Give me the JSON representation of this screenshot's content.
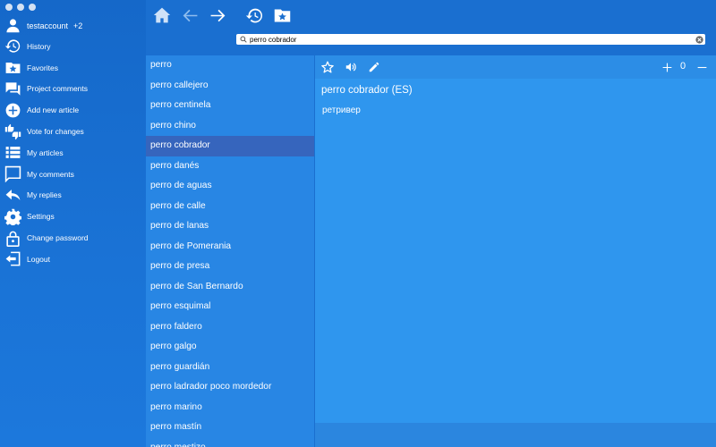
{
  "window": {
    "traffic_lights": [
      "close",
      "minimize",
      "zoom"
    ]
  },
  "user": {
    "name": "testaccount",
    "badge": "+2"
  },
  "sidebar": {
    "items": [
      {
        "label": "History",
        "icon": "history-icon"
      },
      {
        "label": "Favorites",
        "icon": "favorites-icon"
      },
      {
        "label": "Project comments",
        "icon": "comments-icon"
      },
      {
        "label": "Add new article",
        "icon": "add-icon"
      },
      {
        "label": "Vote for changes",
        "icon": "vote-icon"
      },
      {
        "label": "My articles",
        "icon": "articles-icon"
      },
      {
        "label": "My comments",
        "icon": "comment-icon"
      },
      {
        "label": "My replies",
        "icon": "reply-icon"
      },
      {
        "label": "Settings",
        "icon": "gear-icon"
      },
      {
        "label": "Change password",
        "icon": "lock-icon"
      },
      {
        "label": "Logout",
        "icon": "logout-icon"
      }
    ]
  },
  "toolbar": {
    "icons": [
      "home-icon",
      "back-arrow-icon",
      "forward-arrow-icon",
      "history-icon",
      "favorites-folder-icon"
    ]
  },
  "search": {
    "value": "perro cobrador",
    "placeholder": ""
  },
  "wordlist": {
    "selected_index": 4,
    "items": [
      "perro",
      "perro callejero",
      "perro centinela",
      "perro chino",
      "perro cobrador",
      "perro danés",
      "perro de aguas",
      "perro de calle",
      "perro de lanas",
      "perro de Pomerania",
      "perro de presa",
      "perro de San Bernardo",
      "perro esquimal",
      "perro faldero",
      "perro galgo",
      "perro guardián",
      "perro ladrador poco mordedor",
      "perro marino",
      "perro mastín",
      "perro mestizo"
    ]
  },
  "entry": {
    "title": "perro cobrador (ES)",
    "translation": "ретривер",
    "counter": "0",
    "toolbar_icons": [
      "star-icon",
      "speaker-icon",
      "pencil-icon",
      "plus-icon",
      "minus-icon"
    ]
  },
  "colors": {
    "sidebar_bg": "#1568c9",
    "list_bg": "#2886e4",
    "selected_bg": "#3665bd",
    "content_bg": "#2f96ee"
  }
}
